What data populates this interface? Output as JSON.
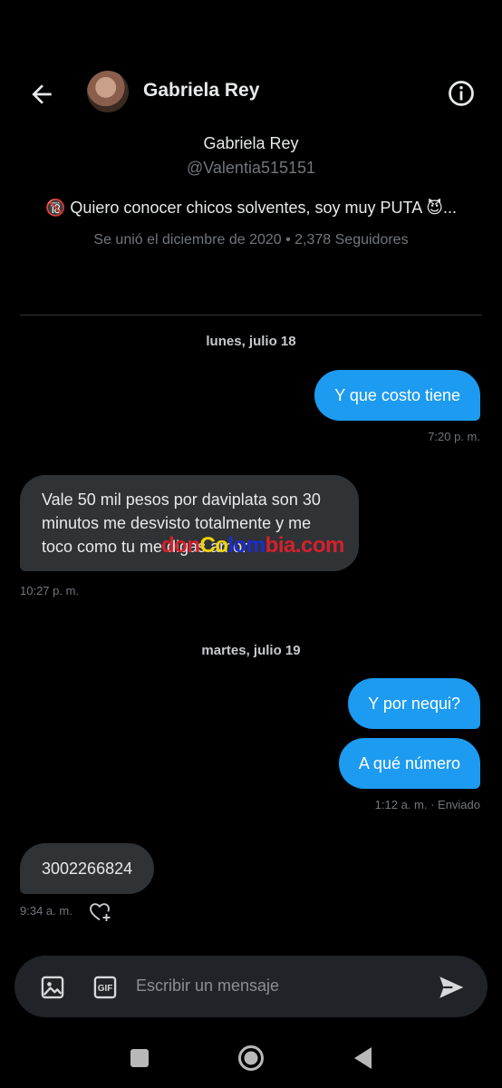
{
  "header": {
    "title": "Gabriela Rey"
  },
  "profile": {
    "name": "Gabriela Rey",
    "handle": "@Valentia515151",
    "bio": "🔞 Quiero conocer chicos solventes, soy muy PUTA 😈...",
    "meta": "Se unió el diciembre de 2020 • 2,378 Seguidores"
  },
  "conversation": {
    "date1": "lunes, julio 18",
    "msg1": {
      "text": "Y que costo tiene",
      "time": "7:20 p. m."
    },
    "msg2": {
      "text": "Vale 50 mil pesos por daviplata son 30 minutos me desvisto totalmente y me toco como tu me digas amor",
      "time": "10:27 p. m."
    },
    "date2": "martes, julio 19",
    "msg3": {
      "text": "Y por nequi?"
    },
    "msg4": {
      "text": "A qué número",
      "time": "1:12 a. m. · Enviado"
    },
    "msg5": {
      "text": "3002266824",
      "time": "9:34 a. m."
    }
  },
  "watermark": {
    "part1": "don",
    "part2": "Co",
    "part3": "lom",
    "part4": "bia.com"
  },
  "composer": {
    "placeholder": "Escribir un mensaje",
    "gif_label": "GIF"
  },
  "icons": {
    "back": "arrow-left-icon",
    "info": "info-icon",
    "image": "image-icon",
    "gif": "gif-icon",
    "send": "send-icon",
    "heart": "heart-plus-icon"
  },
  "colors": {
    "accent": "#1d9bf0",
    "bubble_in": "#2f3336",
    "background": "#000000"
  }
}
